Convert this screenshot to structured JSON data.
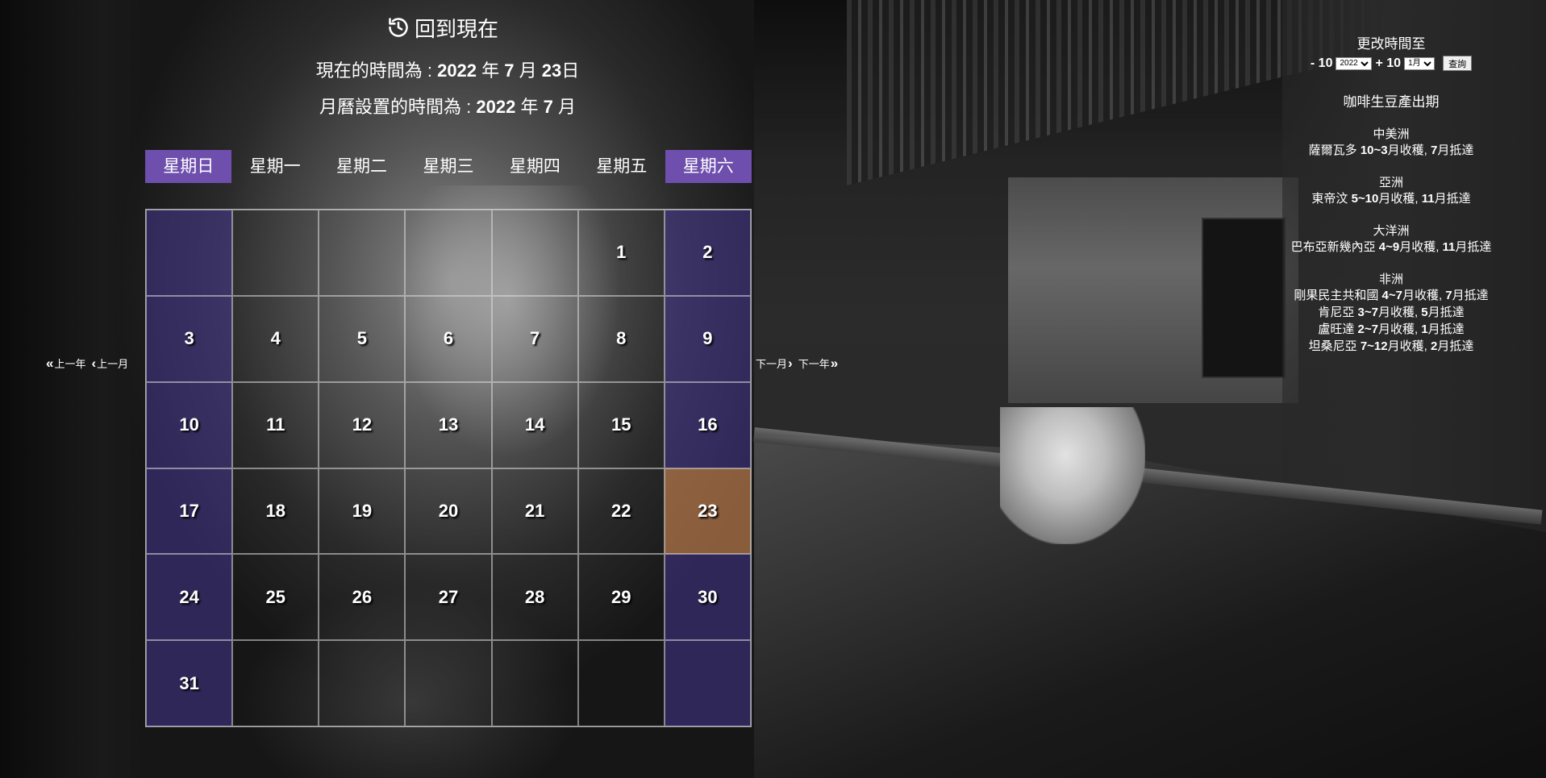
{
  "header": {
    "back_now_label": "回到現在",
    "now_prefix": "現在的時間為 : ",
    "now_year": "2022",
    "now_year_unit": " 年 ",
    "now_month": "7",
    "now_month_unit": " 月 ",
    "now_day": "23",
    "now_day_unit": "日",
    "set_prefix": "月曆設置的時間為 : ",
    "set_year": "2022",
    "set_year_unit": " 年 ",
    "set_month": "7",
    "set_month_unit": " 月"
  },
  "calendar": {
    "weekdays": [
      "星期日",
      "星期一",
      "星期二",
      "星期三",
      "星期四",
      "星期五",
      "星期六"
    ],
    "weekend_accent": "#6e4fad",
    "today_color": "#c8824f",
    "today_value": "23",
    "days": [
      "",
      "",
      "",
      "",
      "",
      "1",
      "2",
      "3",
      "4",
      "5",
      "6",
      "7",
      "8",
      "9",
      "10",
      "11",
      "12",
      "13",
      "14",
      "15",
      "16",
      "17",
      "18",
      "19",
      "20",
      "21",
      "22",
      "23",
      "24",
      "25",
      "26",
      "27",
      "28",
      "29",
      "30",
      "31",
      "",
      "",
      "",
      "",
      "",
      ""
    ]
  },
  "nav": {
    "prev_year": "上一年",
    "prev_month": "上一月",
    "next_month": "下一月",
    "next_year": "下一年"
  },
  "sidebar": {
    "change_title": "更改時間至",
    "minus_label": "- 10",
    "year_selected": "2022",
    "plus_label": "+ 10",
    "month_selected": "1月",
    "query_label": "查詢",
    "ship_title": "咖啡生豆產出期",
    "regions": [
      {
        "name": "中美洲",
        "lines": [
          {
            "country": "薩爾瓦多 ",
            "harvest": "10~3",
            "harvest_unit": "月收穫, ",
            "arrive": "7",
            "arrive_unit": "月抵達"
          }
        ]
      },
      {
        "name": "亞洲",
        "lines": [
          {
            "country": "東帝汶 ",
            "harvest": "5~10",
            "harvest_unit": "月收穫, ",
            "arrive": "11",
            "arrive_unit": "月抵達"
          }
        ]
      },
      {
        "name": "大洋洲",
        "lines": [
          {
            "country": "巴布亞新幾內亞 ",
            "harvest": "4~9",
            "harvest_unit": "月收穫, ",
            "arrive": "11",
            "arrive_unit": "月抵達"
          }
        ]
      },
      {
        "name": "非洲",
        "lines": [
          {
            "country": "剛果民主共和國 ",
            "harvest": "4~7",
            "harvest_unit": "月收穫, ",
            "arrive": "7",
            "arrive_unit": "月抵達"
          },
          {
            "country": "肯尼亞 ",
            "harvest": "3~7",
            "harvest_unit": "月收穫, ",
            "arrive": "5",
            "arrive_unit": "月抵達"
          },
          {
            "country": "盧旺達 ",
            "harvest": "2~7",
            "harvest_unit": "月收穫, ",
            "arrive": "1",
            "arrive_unit": "月抵達"
          },
          {
            "country": "坦桑尼亞 ",
            "harvest": "7~12",
            "harvest_unit": "月收穫, ",
            "arrive": "2",
            "arrive_unit": "月抵達"
          }
        ]
      }
    ]
  }
}
